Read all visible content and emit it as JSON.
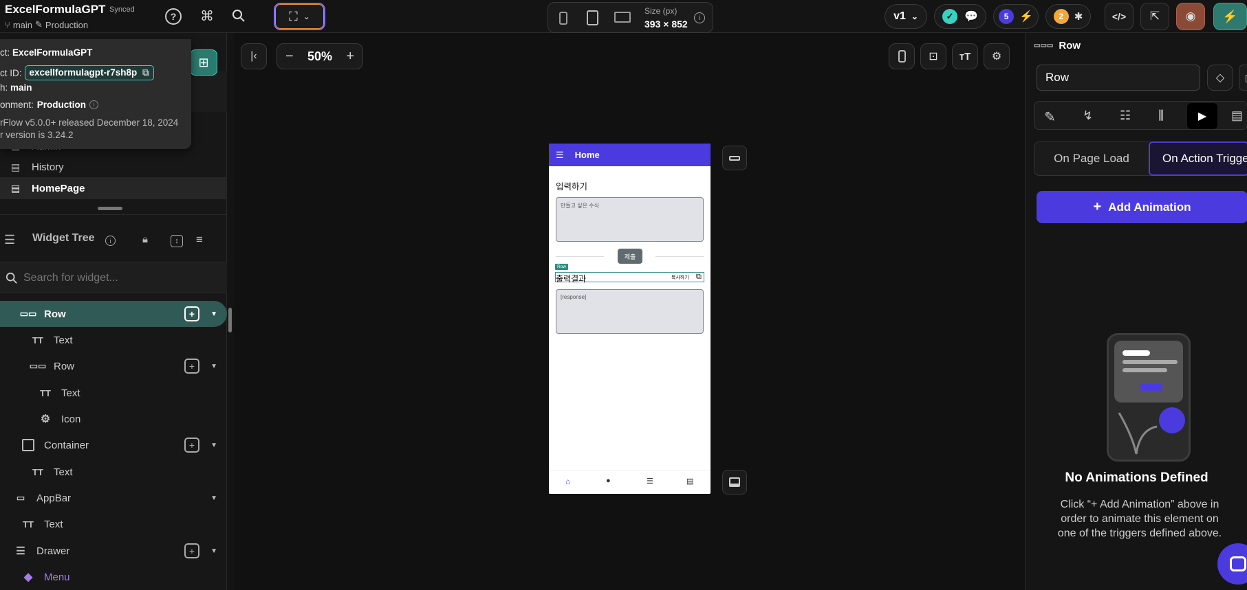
{
  "project": {
    "name": "ExcelFormulaGPT",
    "sync_status": "Synced",
    "branch": "main",
    "environment": "Production"
  },
  "tooltip": {
    "project_label": "ct:",
    "project_value": "ExcelFormulaGPT",
    "project_id_label": "ct ID:",
    "project_id_value": "excellformulagpt-r7sh8p",
    "branch_label": "h:",
    "branch_value": "main",
    "environment_label": "onment:",
    "environment_value": "Production",
    "release_note": "rFlow v5.0.0+ released December 18, 2024",
    "version_note": "r version is 3.24.2"
  },
  "device_bar": {
    "size_label": "Size (px)",
    "size_value": "393 × 852"
  },
  "version_select": "v1",
  "badges": {
    "lightning_count": "5",
    "bug_count": "2"
  },
  "pages": {
    "items": [
      "Admin",
      "History",
      "HomePage"
    ],
    "selected": "HomePage"
  },
  "widget_tree": {
    "title": "Widget Tree",
    "search_placeholder": "Search for widget...",
    "items": [
      {
        "label": "Row",
        "icon": "row-icon"
      },
      {
        "label": "Text",
        "icon": "text-icon"
      },
      {
        "label": "Row",
        "icon": "row-icon"
      },
      {
        "label": "Text",
        "icon": "text-icon"
      },
      {
        "label": "Icon",
        "icon": "gear-icon"
      },
      {
        "label": "Container",
        "icon": "container-icon"
      },
      {
        "label": "Text",
        "icon": "text-icon"
      },
      {
        "label": "AppBar",
        "icon": "appbar-icon"
      },
      {
        "label": "Text",
        "icon": "text-icon"
      },
      {
        "label": "Drawer",
        "icon": "drawer-icon"
      },
      {
        "label": "Menu",
        "icon": "diamond-icon"
      }
    ]
  },
  "zoom": "50%",
  "phone_preview": {
    "appbar_title": "Home",
    "input_label": "입력하기",
    "input_placeholder": "만들고 싶은 수식",
    "submit_label": "제출",
    "row_tag": "Row",
    "output_label": "출력결과",
    "copy_label": "복사하기",
    "response_text": "[response]"
  },
  "right_panel": {
    "selected_widget": "Row",
    "name_field": "Row",
    "tab_page_load": "On Page Load",
    "tab_action_trigger": "On Action Trigge",
    "add_animation": "Add Animation",
    "empty_title": "No Animations Defined",
    "empty_desc": "Click “+ Add Animation” above in order to animate this element on one of the triggers defined above."
  },
  "colors": {
    "accent": "#4b3bdf",
    "teal": "#39d2c0",
    "selected_row": "#2f5a55",
    "orange": "#f3a73b"
  }
}
